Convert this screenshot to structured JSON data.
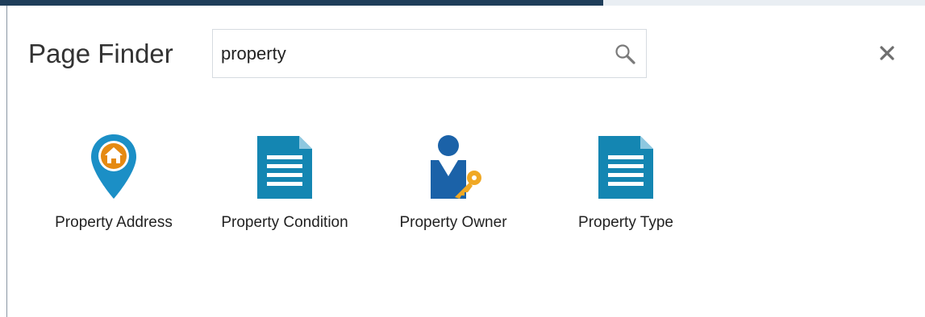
{
  "dialog": {
    "title": "Page Finder",
    "search": {
      "value": "property",
      "placeholder": ""
    },
    "close_icon": "close-icon"
  },
  "results": [
    {
      "label": "Property Address",
      "icon": "location-pin-house-icon"
    },
    {
      "label": "Property Condition",
      "icon": "document-icon"
    },
    {
      "label": "Property Owner",
      "icon": "person-key-icon"
    },
    {
      "label": "Property Type",
      "icon": "document-icon"
    }
  ],
  "colors": {
    "icon_blue": "#1b8fc6",
    "icon_teal": "#1486b2",
    "owner_blue": "#1b62a8",
    "accent_orange": "#e58a12",
    "key_gold": "#f0a824"
  }
}
